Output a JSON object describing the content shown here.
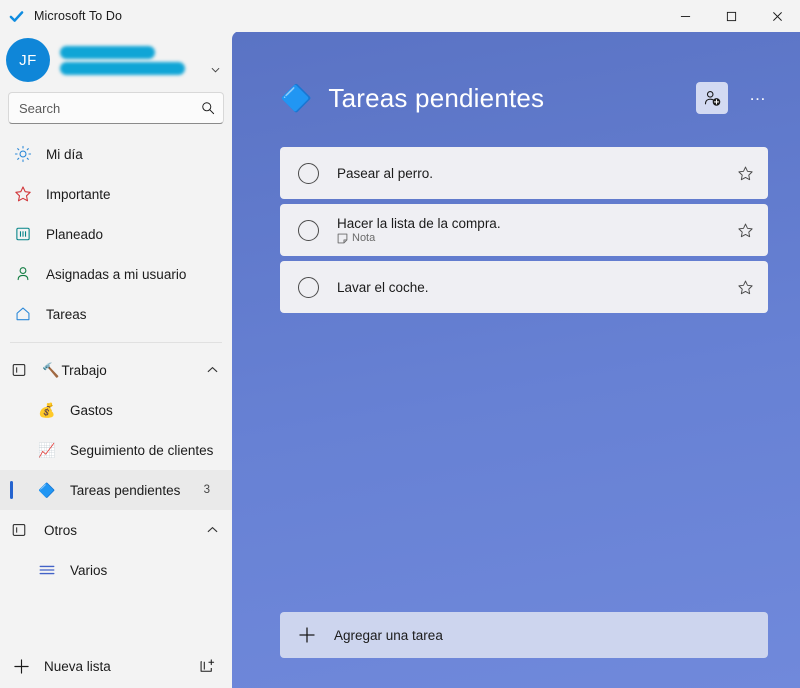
{
  "window": {
    "app_icon": "checkmark-icon",
    "title": "Microsoft To Do",
    "minimize_label": "─",
    "maximize_label": "□",
    "close_label": "✕"
  },
  "account": {
    "avatar_initials": "JF",
    "name_redacted": "",
    "email_redacted": "",
    "chevron": "⌄"
  },
  "search": {
    "placeholder": "Search",
    "value": "",
    "icon": "search-icon"
  },
  "sidebar": {
    "smart_lists": [
      {
        "label": "Mi día",
        "icon": "sun-icon",
        "color": "#2B88D8"
      },
      {
        "label": "Importante",
        "icon": "star-icon",
        "color": "#D13438"
      },
      {
        "label": "Planeado",
        "icon": "calendar-icon",
        "color": "#038387"
      },
      {
        "label": "Asignadas a mi usuario",
        "icon": "person-icon",
        "color": "#107C41"
      },
      {
        "label": "Tareas",
        "icon": "home-icon",
        "color": "#2B88D8"
      }
    ],
    "groups": [
      {
        "label": "Trabajo",
        "emoji": "🔨",
        "group_icon": "group-icon",
        "chevron": "chevron-up-icon",
        "lists": [
          {
            "label": "Gastos",
            "emoji": "💰",
            "count": "",
            "selected": false
          },
          {
            "label": "Seguimiento de clientes",
            "emoji": "📈",
            "count": "",
            "selected": false
          },
          {
            "label": "Tareas pendientes",
            "emoji": "🔷",
            "count": "3",
            "selected": true
          }
        ]
      },
      {
        "label": "Otros",
        "emoji": "",
        "group_icon": "group-icon",
        "chevron": "chevron-up-icon",
        "lists": [
          {
            "label": "Varios",
            "emoji": "list-icon",
            "count": "",
            "selected": false
          }
        ]
      }
    ],
    "new_list": {
      "label": "Nueva lista",
      "plus_icon": "plus-icon",
      "new_group_icon": "new-group-icon"
    }
  },
  "main": {
    "list_emoji": "🔷",
    "title": "Tareas pendientes",
    "share_icon": "add-person-icon",
    "more_icon": "…",
    "accent_color": "#6780D3",
    "tasks": [
      {
        "title": "Pasear al perro.",
        "note": "",
        "starred": false
      },
      {
        "title": "Hacer la lista de la compra.",
        "note": "Nota",
        "note_icon": "note-icon",
        "starred": false
      },
      {
        "title": "Lavar el coche.",
        "note": "",
        "starred": false
      }
    ],
    "add_task": {
      "label": "Agregar una tarea",
      "plus_icon": "plus-icon"
    }
  }
}
